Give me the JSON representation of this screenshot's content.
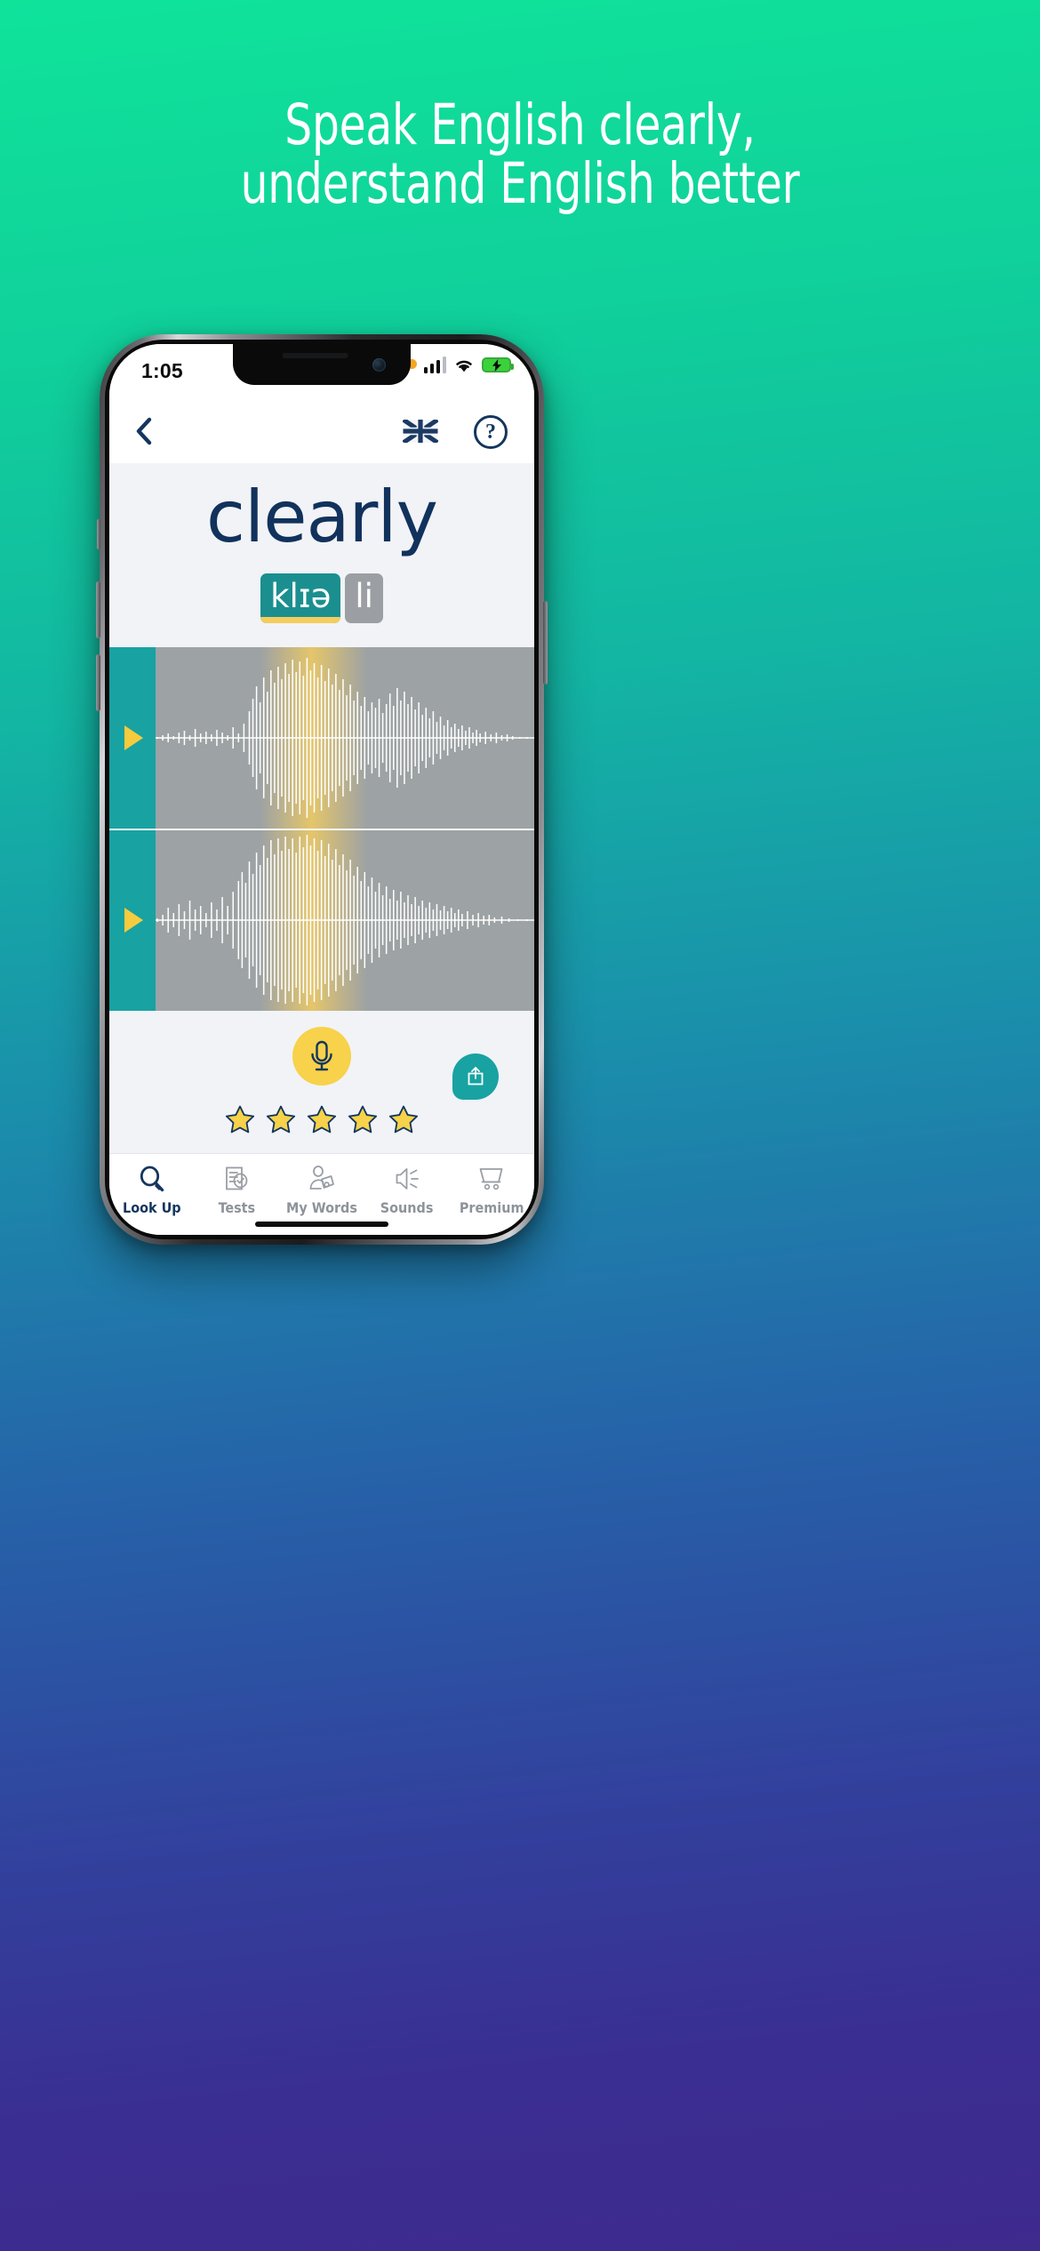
{
  "promo": {
    "headline_line1": "Speak English clearly,",
    "headline_line2": "understand English better",
    "background_from": "#0fe39a",
    "background_to": "#3f2a8e"
  },
  "status_bar": {
    "time": "1:05",
    "recording_indicator": "orange-dot-icon",
    "cellular": "signal-bars-icon",
    "wifi": "wifi-icon",
    "battery": "battery-charging-icon",
    "battery_color": "#3ad23a"
  },
  "nav_bar": {
    "back": "chevron-left-icon",
    "language_flag": "uk-flag-icon",
    "help_label": "?"
  },
  "word": {
    "text": "clearly",
    "color": "#11325c",
    "syllables": [
      {
        "ipa": "klɪə",
        "stressed": true,
        "color": "#1b8f8f"
      },
      {
        "ipa": "li",
        "stressed": false,
        "color": "#9b9fa4"
      }
    ],
    "stress_underline_color": "#f4cd5e"
  },
  "waveforms": [
    {
      "name": "reference-audio",
      "play_label": "play-icon",
      "accent": "#18a2a2",
      "play_color": "#f7cb3e"
    },
    {
      "name": "user-recording",
      "play_label": "play-icon",
      "accent": "#18a2a2",
      "play_color": "#f7cb3e"
    }
  ],
  "record": {
    "mic_label": "microphone-icon",
    "mic_bg": "#f7d24a",
    "share_label": "share-icon",
    "share_bg": "#18a2a2",
    "rating": 5,
    "rating_max": 5,
    "star_fill": "#f7d24a",
    "star_stroke": "#14365e"
  },
  "tabs": [
    {
      "label": "Look Up",
      "icon": "magnifier-icon",
      "active": true
    },
    {
      "label": "Tests",
      "icon": "document-check-icon",
      "active": false
    },
    {
      "label": "My Words",
      "icon": "person-reading-icon",
      "active": false
    },
    {
      "label": "Sounds",
      "icon": "speaker-icon",
      "active": false
    },
    {
      "label": "Premium",
      "icon": "shopping-cart-icon",
      "active": false
    }
  ]
}
